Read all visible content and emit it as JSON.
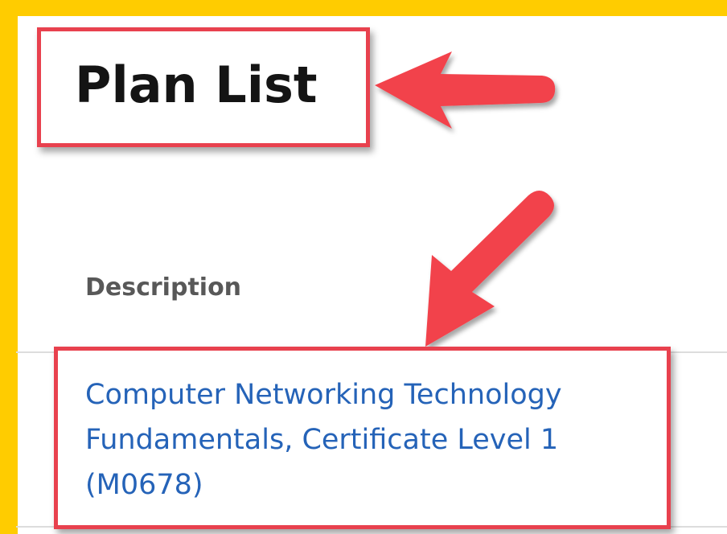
{
  "page": {
    "title": "Plan List"
  },
  "table": {
    "columns": [
      "Description"
    ],
    "rows": [
      {
        "description": "Computer Networking Technology Fundamentals, Certificate Level 1 (M0678)"
      }
    ]
  },
  "colors": {
    "frame": "#FFCC00",
    "highlight_border": "#E8414E",
    "arrow": "#F2424C",
    "link": "#2563B8",
    "header_text": "#585858"
  }
}
